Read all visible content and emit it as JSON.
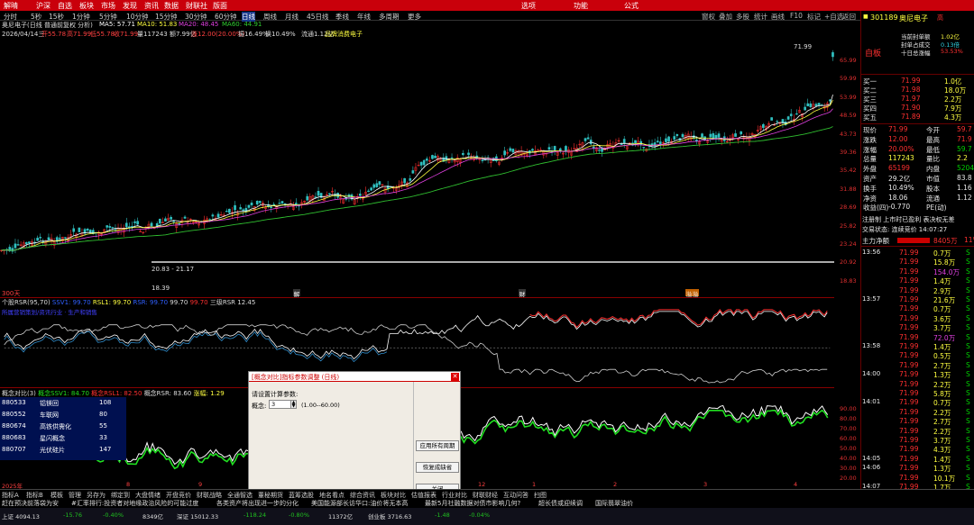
{
  "menu": [
    "解晴",
    "沪深",
    "自选",
    "板块",
    "市场",
    "发现",
    "资讯",
    "数据",
    "财联社",
    "版面"
  ],
  "menu_center": [
    "选项",
    "功能",
    "公式"
  ],
  "timeframes": [
    "分时",
    "5秒",
    "15秒",
    "1分钟",
    "5分钟",
    "10分钟",
    "15分钟",
    "30分钟",
    "60分钟",
    "日线",
    "周线",
    "月线",
    "45日线",
    "季线",
    "年线",
    "多周期",
    "更多"
  ],
  "timeframe_active": "日线",
  "toolbar_right": [
    "窗权",
    "叠加",
    "多股",
    "统计",
    "画线",
    "F10",
    "标记",
    "+自选",
    "返回"
  ],
  "info1": [
    "奥尼电子(日线 普通前复权 分析)",
    "MA5: 57.71",
    "MA10: 51.83",
    "MA20: 48.45",
    "MA60: 44.91"
  ],
  "info2": [
    "2026/04/14三",
    "开55.78",
    "高71.99",
    "低55.78",
    "收71.99",
    "量117243",
    "额7.99亿",
    "涨12.00(20.00%)",
    "振16.49%",
    "换10.49%",
    "流通1.12亿",
    "品牌消费电子"
  ],
  "price_axis": [
    "65.99",
    "59.99",
    "53.99",
    "48.59",
    "43.73",
    "39.36",
    "35.42",
    "31.88",
    "28.69",
    "25.82",
    "23.24",
    "20.92",
    "18.83"
  ],
  "chart_labels": {
    "high": "71.99",
    "low": "18.39",
    "range": "20.83 - 21.17",
    "count": "300天"
  },
  "event_markers": [
    "解",
    "财",
    "溢"
  ],
  "rsr_header": [
    "个股RSR(95,70)",
    "SSV1: 99.70",
    "RSL1: 99.70",
    "RSR: 99.70",
    "99.70",
    "99.70",
    "三级RSR 12.45"
  ],
  "rsr_sub": "所属营销策划/资讯行业 · 生产和销售",
  "conc_header": [
    "概念对比(3)",
    "概念SSV1: 84.70",
    "概念RSL1: 82.50",
    "概念RSR: 83.60",
    "涨幅: 1.29"
  ],
  "conc_axis": [
    "90.00",
    "80.00",
    "70.00",
    "60.00",
    "50.00",
    "40.00",
    "30.00",
    "20.00"
  ],
  "stock_list": [
    {
      "code": "880533",
      "name": "铝镁回",
      "val": "108"
    },
    {
      "code": "880552",
      "name": "车联网",
      "val": "80"
    },
    {
      "code": "880674",
      "name": "高铁供需化",
      "val": "55"
    },
    {
      "code": "880683",
      "name": "星闪概念",
      "val": "33"
    },
    {
      "code": "880707",
      "name": "光伏硅片",
      "val": "147"
    }
  ],
  "x_dates": [
    "2025年",
    "8",
    "9",
    "10",
    "11",
    "12",
    "1",
    "2",
    "3",
    "4"
  ],
  "dialog": {
    "title": "[概念对比]指标参数调整 (日线)",
    "prompt": "请设置计算参数:",
    "param_label": "概念:",
    "param_value": "3",
    "param_range": "(1.00--60.00)",
    "buttons": [
      "应用所有周期",
      "恢复成缺省",
      "关闭"
    ]
  },
  "right_panel": {
    "code": "301189",
    "name": "奥尼电子",
    "suffix": "高",
    "notes": [
      {
        "label": "当前封单额",
        "val": "1.02亿"
      },
      {
        "label": "封单占成交",
        "val": "0.13倍"
      },
      {
        "label": "十日总涨幅",
        "val": "53.53%"
      }
    ],
    "board_label": "自板",
    "buy_rows": [
      {
        "label": "买一",
        "price": "71.99",
        "vol": "1.0亿"
      },
      {
        "label": "买二",
        "price": "71.98",
        "vol": "18.0万"
      },
      {
        "label": "买三",
        "price": "71.97",
        "vol": "2.2万"
      },
      {
        "label": "买四",
        "price": "71.90",
        "vol": "7.9万"
      },
      {
        "label": "买五",
        "price": "71.89",
        "vol": "4.3万"
      }
    ],
    "quote_rows": [
      {
        "l1": "现价",
        "v1": "71.99",
        "l2": "今开",
        "v2": "59.7"
      },
      {
        "l1": "涨跌",
        "v1": "12.00",
        "l2": "最高",
        "v2": "71.9"
      },
      {
        "l1": "涨幅",
        "v1": "20.00%",
        "l2": "最低",
        "v2": "59.7"
      },
      {
        "l1": "总量",
        "v1": "117243",
        "l2": "量比",
        "v2": "2.2"
      },
      {
        "l1": "外盘",
        "v1": "65199",
        "l2": "内盘",
        "v2": "5204"
      },
      {
        "l1": "资产",
        "v1": "29.2亿",
        "l2": "市值",
        "v2": "83.8"
      },
      {
        "l1": "换手",
        "v1": "10.49%",
        "l2": "股本",
        "v2": "1.16"
      },
      {
        "l1": "净资",
        "v1": "18.06",
        "l2": "流通",
        "v2": "1.12"
      },
      {
        "l1": "收益(四)",
        "v1": "-0.770",
        "l2": "PE(动)",
        "v2": ""
      }
    ],
    "reg_line": "注册制 上市时已盈利 表决权无差",
    "trade_status": "交易状态: 连续竞价 14:07:27",
    "net_flow": {
      "label": "主力净额",
      "val": "8405万",
      "pct": "11%"
    },
    "ticks": [
      {
        "t": "13:56",
        "p": "71.99",
        "v": "0.7万",
        "s": "S"
      },
      {
        "t": "",
        "p": "71.99",
        "v": "15.8万",
        "s": "S"
      },
      {
        "t": "",
        "p": "71.99",
        "v": "154.0万",
        "s": "S"
      },
      {
        "t": "",
        "p": "71.99",
        "v": "1.4万",
        "s": "S"
      },
      {
        "t": "",
        "p": "71.99",
        "v": "2.9万",
        "s": "S"
      },
      {
        "t": "13:57",
        "p": "71.99",
        "v": "21.6万",
        "s": "S"
      },
      {
        "t": "",
        "p": "71.99",
        "v": "0.7万",
        "s": "S"
      },
      {
        "t": "",
        "p": "71.99",
        "v": "3.6万",
        "s": "S"
      },
      {
        "t": "",
        "p": "71.99",
        "v": "3.7万",
        "s": "S"
      },
      {
        "t": "",
        "p": "71.99",
        "v": "72.0万",
        "s": "S"
      },
      {
        "t": "13:58",
        "p": "71.99",
        "v": "1.4万",
        "s": "S"
      },
      {
        "t": "",
        "p": "71.99",
        "v": "0.5万",
        "s": "S"
      },
      {
        "t": "",
        "p": "71.99",
        "v": "2.7万",
        "s": "S"
      },
      {
        "t": "14:00",
        "p": "71.99",
        "v": "1.3万",
        "s": "S"
      },
      {
        "t": "",
        "p": "71.99",
        "v": "2.2万",
        "s": "S"
      },
      {
        "t": "",
        "p": "71.99",
        "v": "5.8万",
        "s": "S"
      },
      {
        "t": "14:01",
        "p": "71.99",
        "v": "0.7万",
        "s": "S"
      },
      {
        "t": "",
        "p": "71.99",
        "v": "2.2万",
        "s": "S"
      },
      {
        "t": "",
        "p": "71.99",
        "v": "2.7万",
        "s": "S"
      },
      {
        "t": "",
        "p": "71.99",
        "v": "2.2万",
        "s": "S"
      },
      {
        "t": "",
        "p": "71.99",
        "v": "3.7万",
        "s": "S"
      },
      {
        "t": "",
        "p": "71.99",
        "v": "4.3万",
        "s": "S"
      },
      {
        "t": "14:05",
        "p": "71.99",
        "v": "1.4万",
        "s": "S"
      },
      {
        "t": "14:06",
        "p": "71.99",
        "v": "1.3万",
        "s": "S"
      },
      {
        "t": "",
        "p": "71.99",
        "v": "10.1万",
        "s": "S"
      },
      {
        "t": "14:07",
        "p": "71.99",
        "v": "1.7万",
        "s": "S"
      }
    ],
    "bottom_tabs": [
      "笔",
      "价",
      "细",
      "势",
      "联",
      "值",
      "主",
      "筹"
    ]
  },
  "bottom_tabs": [
    "指标A",
    "指标B",
    "模板",
    "管理",
    "另存为",
    "绑定到",
    "大盘情绪",
    "开盘竞价",
    "财联战略",
    "全通智选",
    "董秘期货",
    "蓝筹选股",
    "地名看点",
    "综合资讯",
    "板块对比",
    "估值报表",
    "行业对比",
    "财联财经",
    "互动问答",
    "扫图"
  ],
  "ticker": [
    "赶在预决前落袋为安",
    "#汇率排行:投资者对地缘政治风险的可能过度",
    "各类资产将出现进一步的分化",
    "美国能源部长访华口:油价将无本高",
    "最新5月社融数据对债市影响几何?",
    "超长债或迎续调",
    "国际翡翠油价"
  ],
  "status": [
    "上证 4094.13",
    "-15.76",
    "-0.40%",
    "8349亿",
    "深证 15012.33",
    "-118.24",
    "-0.80%",
    "11372亿",
    "创业板 3716.63",
    "-1.48",
    "-0.04%"
  ]
}
